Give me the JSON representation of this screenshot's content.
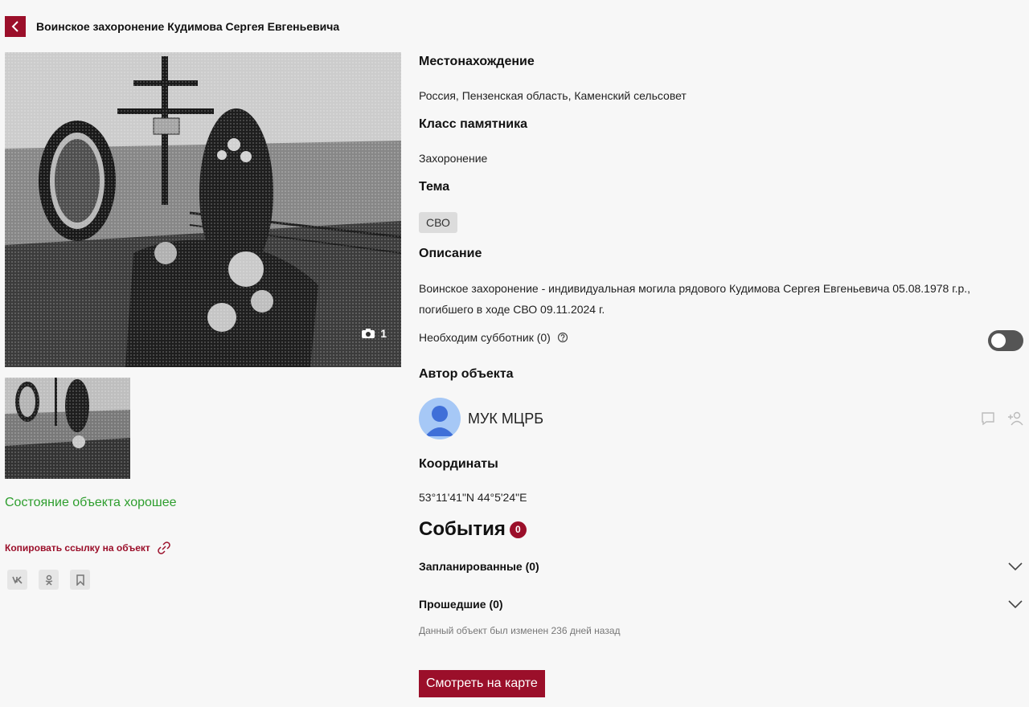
{
  "header": {
    "title": "Воинское захоронение Кудимова Сергея Евгеньевича",
    "back_icon": "chevron-left-icon"
  },
  "gallery": {
    "photo_count": "1",
    "camera_icon": "camera-icon"
  },
  "status": "Состояние объекта хорошее",
  "copy_link": {
    "label": "Копировать ссылку на объект",
    "icon": "link-icon"
  },
  "share": [
    "vk-icon",
    "odnoklassniki-icon",
    "bookmark-icon"
  ],
  "location": {
    "title": "Местонахождение",
    "value": "Россия, Пензенская область, Каменский сельсовет"
  },
  "monument_class": {
    "title": "Класс памятника",
    "value": "Захоронение"
  },
  "theme": {
    "title": "Тема",
    "tag": "СВО"
  },
  "description": {
    "title": "Описание",
    "line1": "Воинское захоронение - индивидуальная могила рядового Кудимова Сергея Евгеньевича 05.08.1978 г.р.,",
    "line2": "погибшего в ходе СВО 09.11.2024 г."
  },
  "subbotnik": {
    "label": "Необходим субботник (0)",
    "enabled": false
  },
  "author": {
    "title": "Автор объекта",
    "name": "МУК МЦРБ"
  },
  "coordinates": {
    "title": "Координаты",
    "value": "53°11'41\"N 44°5'24\"E"
  },
  "events": {
    "title": "События",
    "count": "0",
    "planned": "Запланированные (0)",
    "past": "Прошедшие (0)"
  },
  "modified": "Данный объект был изменен 236 дней назад",
  "map_button": "Смотреть на карте",
  "colors": {
    "accent": "#9b0f2a",
    "status_good": "#2e9e2e",
    "background": "#f7f7f7"
  }
}
